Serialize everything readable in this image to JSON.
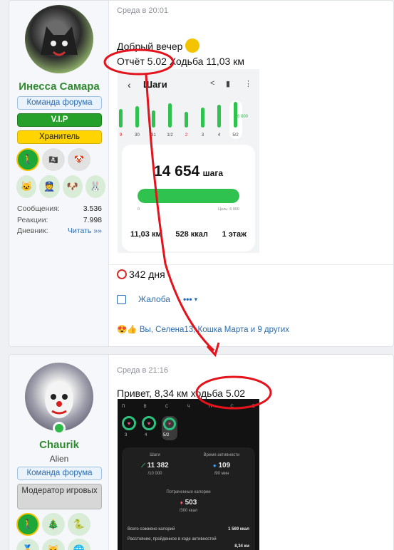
{
  "post1": {
    "author": "Инесса Самара",
    "badges": {
      "team": "Команда форума",
      "vip": "V.I.P",
      "keeper": "Хранитель"
    },
    "stats": [
      {
        "label": "Сообщения:",
        "value": "3.536"
      },
      {
        "label": "Реакции:",
        "value": "7.998"
      },
      {
        "label": "Дневник:",
        "value": "Читать »»"
      }
    ],
    "date": "Среда в 20:01",
    "greeting": "Добрый вечер",
    "report": "Отчёт 5.02 Ходьба 11,03 км",
    "phone": {
      "title": "Шаги",
      "day_labels": [
        "9",
        "30",
        "31",
        "1/2",
        "2",
        "3",
        "4",
        "5/2"
      ],
      "goal_marker": "6 000",
      "steps": "14 654",
      "steps_unit": "шага",
      "progress_fraction": 1.0,
      "scale_min": "0",
      "goal": "Цель: 6 000",
      "distance": "11,03 км",
      "kcal": "528 ккал",
      "floors": "1 этаж"
    },
    "days": "342 дня",
    "report_link": "Жалоба",
    "more": "•••",
    "reactions": "Вы, Селена13, Кошка Марта и 9 других"
  },
  "post2": {
    "author": "Chaurik",
    "user_title": "Alien",
    "badges": {
      "team": "Команда форума",
      "mod": "Модератор игровых"
    },
    "date": "Среда в 21:16",
    "text": "Привет, 8,34 км ходьба 5.02",
    "phone": {
      "week_letters": [
        "П",
        "В",
        "С",
        "Ч",
        "П",
        "С",
        "В"
      ],
      "week_days": [
        "3",
        "4",
        "5/2"
      ],
      "steps_label": "Шаги",
      "steps": "11 382",
      "steps_goal": "/10 000",
      "active_label": "Время активности",
      "active": "109",
      "active_goal": "/90 мин",
      "cal_label": "Потраченные калории",
      "cal": "503",
      "cal_goal": "/300 ккал",
      "total_label": "Всего сожжено калорий",
      "total": "1 569 ккал",
      "dist_label": "Расстояние, пройденное в ходе активностей",
      "dist": "8,34 км"
    }
  },
  "colors": {
    "green": "#25a02a",
    "link": "#2b6cb0",
    "annotation": "#e3121b"
  }
}
